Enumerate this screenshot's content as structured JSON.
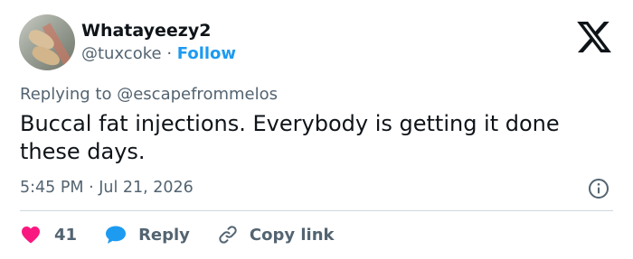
{
  "author": {
    "display_name": "Whatayeezy2",
    "handle": "@tuxcoke",
    "separator": "·",
    "follow_label": "Follow"
  },
  "icons": {
    "avatar": "avatar-photo",
    "logo": "x-logo-icon",
    "info": "info-icon",
    "like": "heart-icon",
    "reply": "speech-bubble-icon",
    "copy": "link-icon"
  },
  "reply_context": {
    "prefix": "Replying to",
    "target": "@escapefrommelos"
  },
  "tweet": {
    "text": "Buccal fat injections. Everybody is getting it done these days.",
    "timestamp": "5:45 PM · Jul 21, 2026"
  },
  "actions": {
    "like_count": "41",
    "reply_label": "Reply",
    "copy_label": "Copy link"
  },
  "colors": {
    "text": "#0f1419",
    "secondary": "#536471",
    "accent": "#1d9bf0",
    "like": "#f91880",
    "divider": "#cfd9de"
  }
}
